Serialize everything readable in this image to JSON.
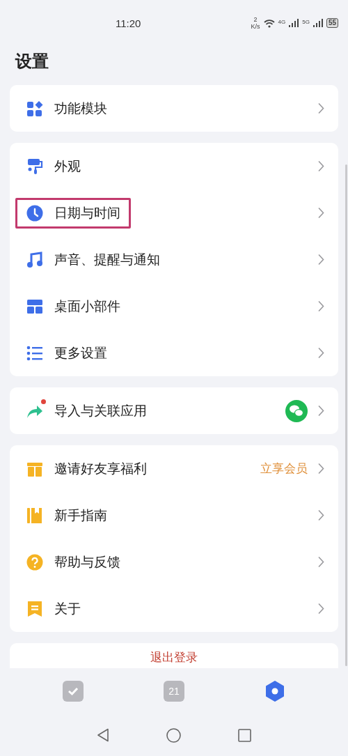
{
  "status_bar": {
    "time": "11:20",
    "speed_value": "2",
    "speed_unit": "K/s",
    "network_1": "4G",
    "network_2": "5G",
    "battery": "55"
  },
  "title": "设置",
  "groups": [
    {
      "items": [
        {
          "kind": "modules",
          "label": "功能模块",
          "highlighted": false
        }
      ]
    },
    {
      "items": [
        {
          "kind": "appearance",
          "label": "外观",
          "highlighted": false
        },
        {
          "kind": "clock",
          "label": "日期与时间",
          "highlighted": true
        },
        {
          "kind": "sound",
          "label": "声音、提醒与通知",
          "highlighted": false
        },
        {
          "kind": "widget",
          "label": "桌面小部件",
          "highlighted": false
        },
        {
          "kind": "more",
          "label": "更多设置",
          "highlighted": false
        }
      ]
    },
    {
      "items": [
        {
          "kind": "import",
          "label": "导入与关联应用",
          "highlighted": false,
          "new_dot": true,
          "linked_app": true
        }
      ]
    },
    {
      "items": [
        {
          "kind": "gift",
          "label": "邀请好友享福利",
          "highlighted": false,
          "value": "立享会员"
        },
        {
          "kind": "guide",
          "label": "新手指南",
          "highlighted": false
        },
        {
          "kind": "help",
          "label": "帮助与反馈",
          "highlighted": false
        },
        {
          "kind": "about",
          "label": "关于",
          "highlighted": false
        }
      ]
    }
  ],
  "logout": "退出登录",
  "tabs": [
    {
      "kind": "tasks",
      "selected": false
    },
    {
      "kind": "calendar",
      "label": "21",
      "selected": false
    },
    {
      "kind": "settings",
      "selected": true
    }
  ]
}
